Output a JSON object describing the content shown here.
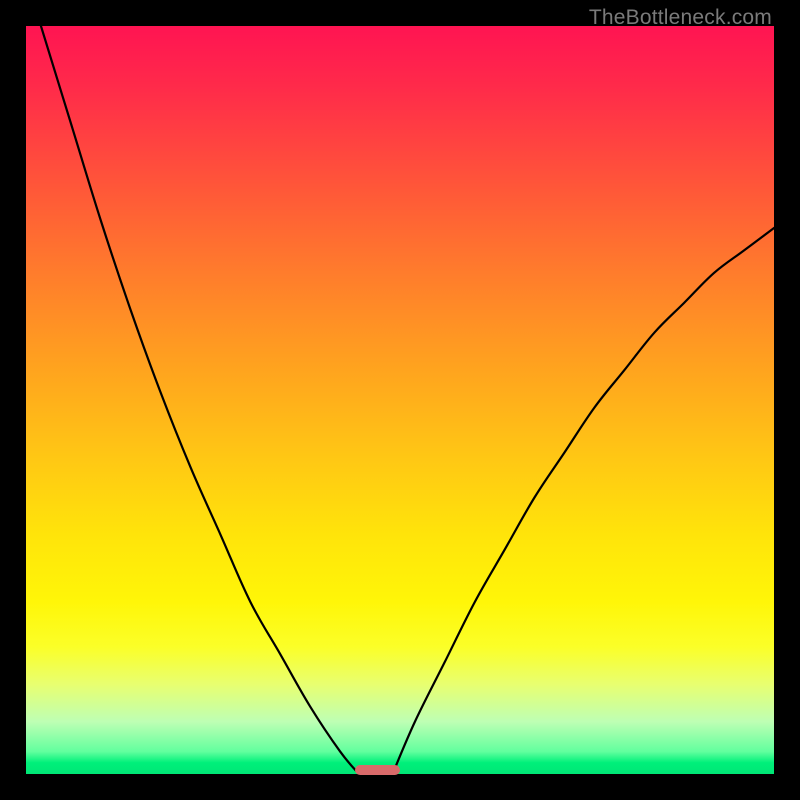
{
  "watermark": "TheBottleneck.com",
  "chart_data": {
    "type": "line",
    "title": "",
    "xlabel": "",
    "ylabel": "",
    "xlim": [
      0,
      100
    ],
    "ylim": [
      0,
      100
    ],
    "grid": false,
    "legend": false,
    "series": [
      {
        "name": "left-branch",
        "x": [
          2,
          6,
          10,
          14,
          18,
          22,
          26,
          30,
          34,
          38,
          42,
          44.5
        ],
        "y": [
          100,
          87,
          74,
          62,
          51,
          41,
          32,
          23,
          16,
          9,
          3,
          0
        ]
      },
      {
        "name": "right-branch",
        "x": [
          49,
          52,
          56,
          60,
          64,
          68,
          72,
          76,
          80,
          84,
          88,
          92,
          96,
          100
        ],
        "y": [
          0,
          7,
          15,
          23,
          30,
          37,
          43,
          49,
          54,
          59,
          63,
          67,
          70,
          73
        ]
      }
    ],
    "marker": {
      "x_center": 47,
      "y": 0.5,
      "width": 6,
      "height": 1.4
    },
    "background_gradient": {
      "top": "#ff1452",
      "mid": "#ffe40a",
      "bottom": "#00e676"
    }
  }
}
